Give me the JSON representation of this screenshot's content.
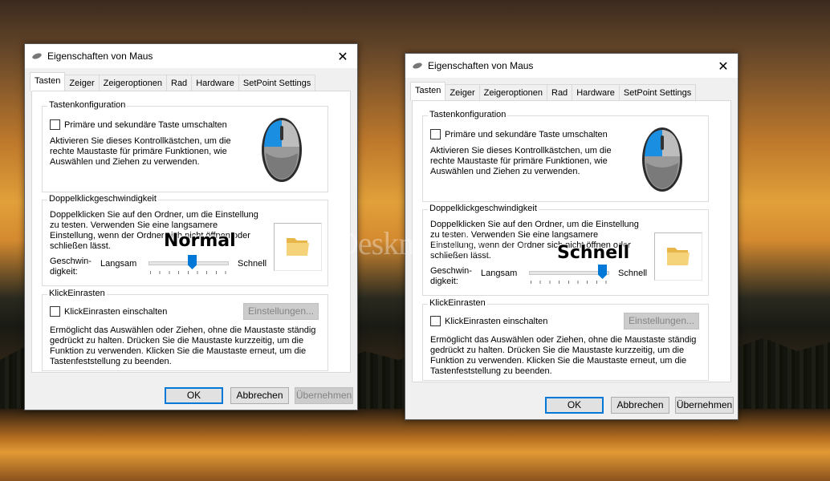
{
  "overlay": {
    "watermark": "Deskmodder.de",
    "label_left": "Normal",
    "label_right": "Schnell"
  },
  "window": {
    "title": "Eigenschaften von Maus",
    "close_glyph": "✕",
    "tabs": [
      "Tasten",
      "Zeiger",
      "Zeigeroptionen",
      "Rad",
      "Hardware",
      "SetPoint Settings"
    ],
    "active_tab": "Tasten",
    "button_config": {
      "title": "Tastenkonfiguration",
      "checkbox_label": "Primäre und sekundäre Taste umschalten",
      "desc1": "Aktivieren Sie dieses Kontrollkästchen, um die",
      "desc2": "rechte Maustaste für primäre Funktionen, wie",
      "desc3": "Auswählen und Ziehen zu verwenden."
    },
    "doubleclick": {
      "title": "Doppelklickgeschwindigkeit",
      "desc1": "Doppelklicken Sie auf den Ordner, um die Einstellung",
      "desc2": "zu testen. Verwenden Sie eine langsamere",
      "desc3": "Einstellung, wenn der Ordner sich nicht öffnen oder",
      "desc4": "schließen lässt.",
      "speed_label1": "Geschwin-",
      "speed_label2": "digkeit:",
      "slow": "Langsam",
      "fast": "Schnell"
    },
    "clicklock": {
      "title": "KlickEinrasten",
      "checkbox_label": "KlickEinrasten einschalten",
      "settings_button": "Einstellungen...",
      "desc1": "Ermöglicht das Auswählen oder Ziehen, ohne die Maustaste ständig",
      "desc2": "gedrückt zu halten. Drücken Sie die Maustaste kurzzeitig, um die",
      "desc3": "Funktion zu verwenden. Klicken Sie die Maustaste erneut, um die",
      "desc4": "Tastenfeststellung zu beenden."
    },
    "buttons": {
      "ok": "OK",
      "cancel": "Abbrechen",
      "apply": "Übernehmen"
    }
  },
  "slider_left_value": 0.55,
  "slider_right_value": 0.97,
  "colors": {
    "accent": "#0078d7"
  }
}
